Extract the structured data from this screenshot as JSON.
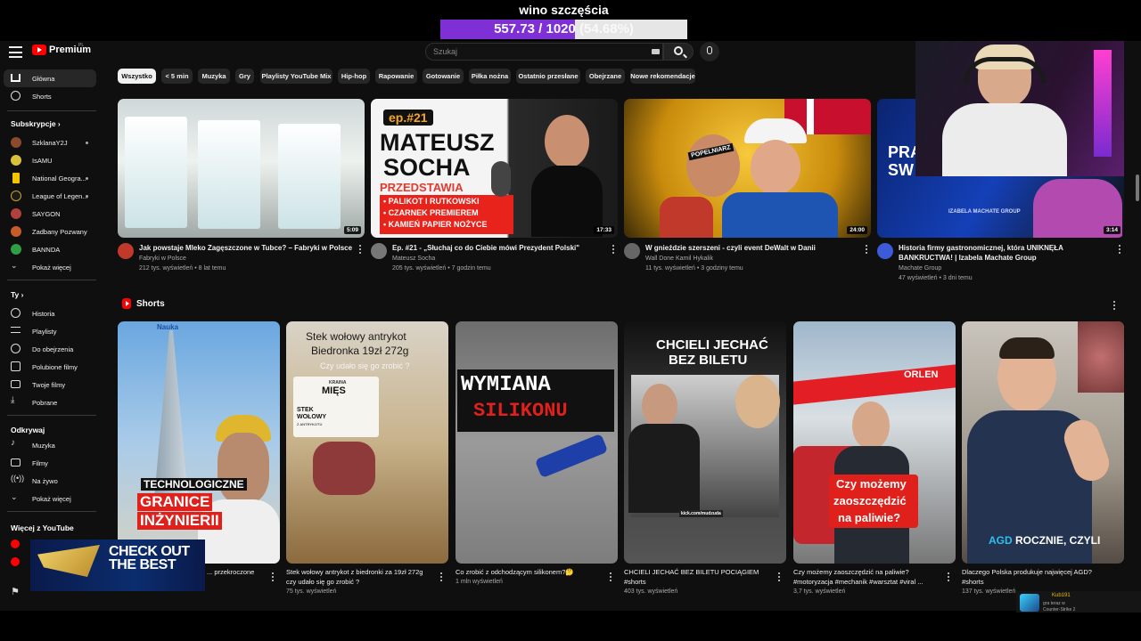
{
  "overlay": {
    "title": "wino szczęścia",
    "progress_text": "557.73 / 1020",
    "progress_pct_text": "(54.68%)",
    "progress_fraction": 0.5468
  },
  "topbar": {
    "logo_text": "Premium",
    "logo_region": "PL",
    "search_placeholder": "Szukaj"
  },
  "sidebar": {
    "main": [
      {
        "label": "Główna",
        "icon": "home-icon",
        "active": true
      },
      {
        "label": "Shorts",
        "icon": "shorts-icon",
        "active": false
      }
    ],
    "subscriptions_header": "Subskrypcje",
    "subscriptions": [
      {
        "label": "SzklanaY2J",
        "color": "#8b4a2b",
        "live": true
      },
      {
        "label": "IsAMU",
        "color": "#d9c23a",
        "live": false
      },
      {
        "label": "National Geogra...",
        "color": "#f5c400",
        "live": true
      },
      {
        "label": "League of Legen...",
        "color": "#c9a227",
        "live": true
      },
      {
        "label": "SAYGON",
        "color": "#b0413e",
        "live": false
      },
      {
        "label": "Zadbany Pozwany",
        "color": "#c85b2a",
        "live": false
      },
      {
        "label": "BANNDA",
        "color": "#2f9e44",
        "live": false
      }
    ],
    "show_more_1": "Pokaż więcej",
    "you_header": "Ty",
    "you": [
      {
        "label": "Historia",
        "icon": "history-icon"
      },
      {
        "label": "Playlisty",
        "icon": "playlist-icon"
      },
      {
        "label": "Do obejrzenia",
        "icon": "watch-later-icon"
      },
      {
        "label": "Polubione filmy",
        "icon": "like-icon"
      },
      {
        "label": "Twoje filmy",
        "icon": "your-videos-icon"
      },
      {
        "label": "Pobrane",
        "icon": "download-icon"
      }
    ],
    "explore_header": "Odkrywaj",
    "explore": [
      {
        "label": "Muzyka",
        "icon": "music-icon"
      },
      {
        "label": "Filmy",
        "icon": "movies-icon"
      },
      {
        "label": "Na żywo",
        "icon": "live-icon"
      }
    ],
    "show_more_2": "Pokaż więcej",
    "more_header": "Więcej z YouTube"
  },
  "chips": [
    "Wszystko",
    "< 5 min",
    "Muzyka",
    "Gry",
    "Playlisty YouTube Mix",
    "Hip-hop",
    "Rapowanie",
    "Gotowanie",
    "Piłka nożna",
    "Ostatnio przesłane",
    "Obejrzane",
    "Nowe rekomendacje"
  ],
  "videos": [
    {
      "title": "Jak powstaje Mleko Zagęszczone w Tubce? – Fabryki w Polsce",
      "channel": "Fabryki w Polsce",
      "stats": "212 tys. wyświetleń • 8 lat temu",
      "duration": "5:09",
      "avatar_color": "#c0392b"
    },
    {
      "title": "Ep. #21 - „Słuchaj co do Ciebie mówi Prezydent Polski\"",
      "channel": "Mateusz Socha",
      "stats": "205 tys. wyświetleń • 7 godzin temu",
      "duration": "17:33",
      "avatar_color": "#777777",
      "art": {
        "ep": "ep.#21",
        "name1": "MATEUSZ",
        "name2": "SOCHA",
        "red": "PRZEDSTAWIA",
        "list": [
          "• PALIKOT I RUTKOWSKI",
          "• CZARNEK PREMIEREM",
          "• KAMIEŃ PAPIER NOŻYCE"
        ]
      }
    },
    {
      "title": "W gnieździe szerszeni - czyli event DeWalt w Danii",
      "channel": "Wall Done Kamil Hykalik",
      "stats": "11 tys. wyświetleń • 3 godziny temu",
      "duration": "24:00",
      "avatar_color": "#666666",
      "art": {
        "tag": "POPELNIARZ"
      }
    },
    {
      "title": "Historia firmy gastronomicznej, która UNIKNĘŁA BANKRUCTWA! | Izabela Machate Group",
      "channel": "Machate Group",
      "stats": "47 wyświetleń • 3 dni temu",
      "duration": "3:14",
      "avatar_color": "#3b5bdb",
      "art": {
        "text1": "PRA",
        "text2": "SW",
        "caption": "IZABELA MACHATE GROUP"
      }
    }
  ],
  "shorts_header": "Shorts",
  "shorts": [
    {
      "title": "... przekroczone",
      "stats": "",
      "art": {
        "badge": "Nauka",
        "line1": "TECHNOLOGICZNE",
        "line2": "GRANICE",
        "line3": "INŻYNIERII"
      }
    },
    {
      "title": "Stek wołowy antrykot z biedronki za 19zł 272g czy udało się go zrobić ?",
      "stats": "75 tys. wyświetleń",
      "art": {
        "line1": "Stek wołowy antrykot",
        "line2": "Biedronka 19zł 272g",
        "line3": "Czy udało się go zrobić ?",
        "label1": "KRAINA",
        "label2": "MIĘS",
        "label3": "STEK",
        "label4": "WOŁOWY",
        "label5": "Z ANTRYKOTU"
      }
    },
    {
      "title": "Co zrobić z odchodzącym silikonem?🤔",
      "stats": "1 mln wyświetleń",
      "art": {
        "line1": "WYMIANA",
        "line2": "SILIKONU"
      }
    },
    {
      "title": "CHCIELI JECHAĆ BEZ BILETU POCIĄGIEM #shorts",
      "stats": "403 tys. wyświetleń",
      "art": {
        "line1": "CHCIELI JECHAĆ",
        "line2": "BEZ BILETU",
        "sub": "kick.com/mudzuda"
      }
    },
    {
      "title": "Czy możemy zaoszczędzić na paliwie? #motoryzacja #mechanik #warsztat #viral ...",
      "stats": "3,7 tys. wyświetleń",
      "art": {
        "sign": "ORLEN",
        "line1": "Czy możemy",
        "line2": "zaoszczędzić",
        "line3": "na paliwie?"
      }
    },
    {
      "title": "Dlaczego Polska produkuje najwięcej AGD? #shorts",
      "stats": "137 tys. wyświetleń",
      "art": {
        "line1": "AGD",
        "line2": "ROCZNIE, CZYLI"
      }
    }
  ],
  "checkout_banner": {
    "line1": "CHECK OUT",
    "line2": "THE BEST"
  },
  "notification": {
    "user": "Kub191",
    "line2": "gra teraz w",
    "line3": "Counter-Strike 2"
  }
}
